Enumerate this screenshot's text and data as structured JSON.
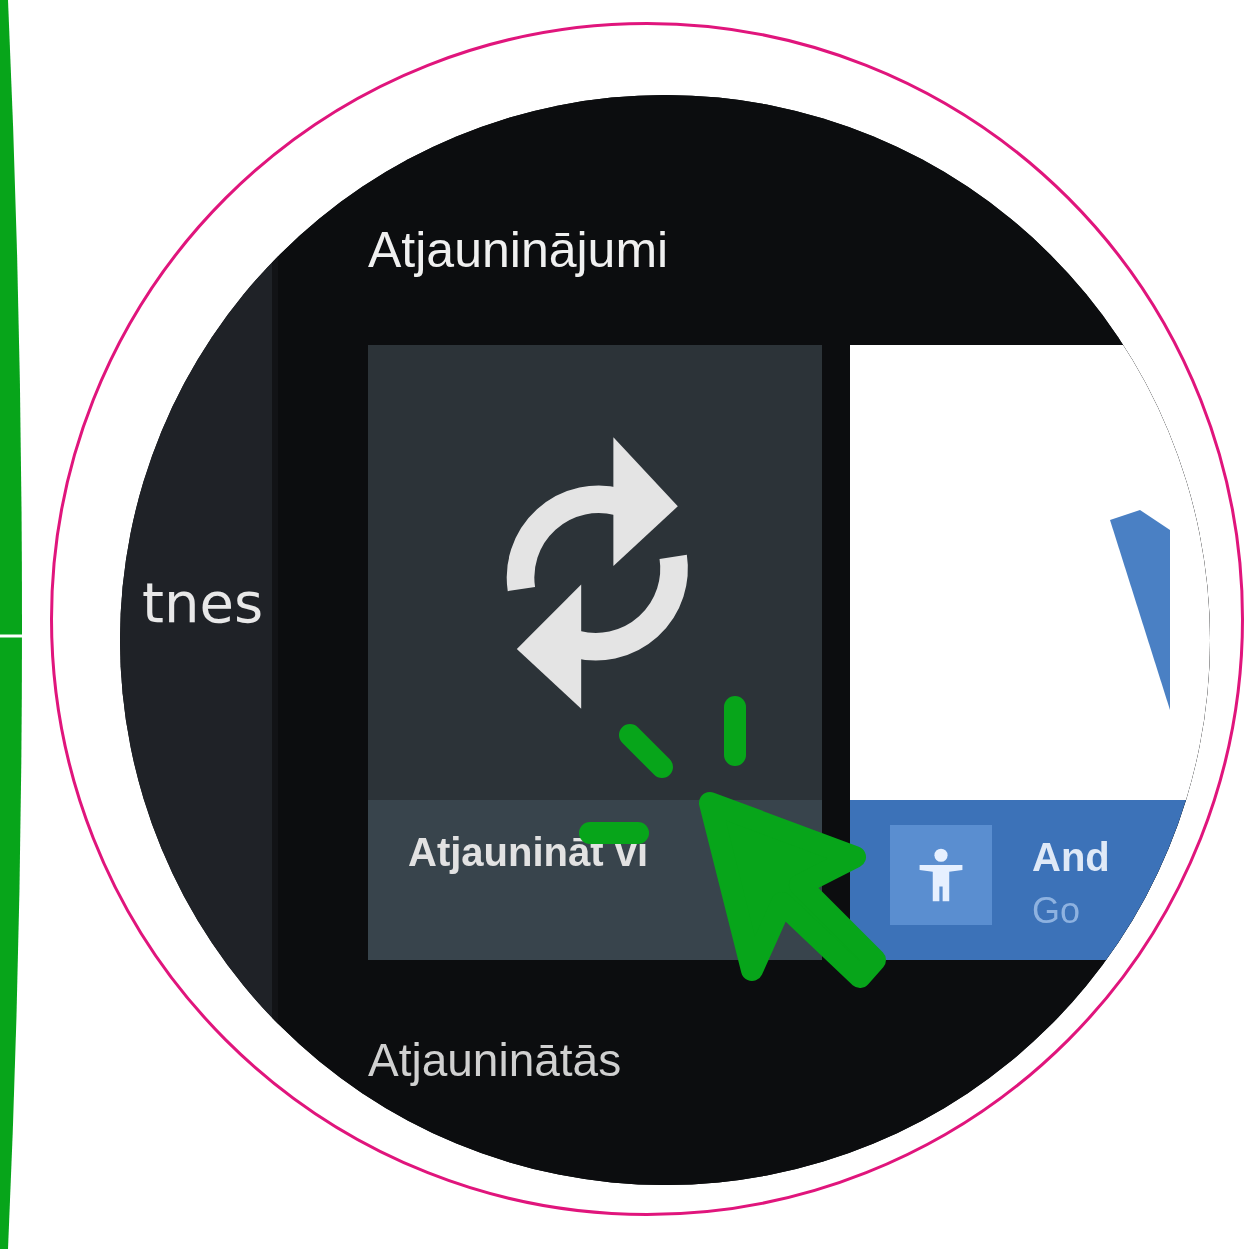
{
  "sidebar": {
    "item": "tnes"
  },
  "sections": [
    {
      "title": "Atjauninājumi"
    },
    {
      "title": "Atjauninātās"
    }
  ],
  "cards": [
    {
      "kind": "action",
      "label": "Atjaunināt vi"
    },
    {
      "kind": "app",
      "title": "And",
      "subtitle": "Go"
    }
  ]
}
